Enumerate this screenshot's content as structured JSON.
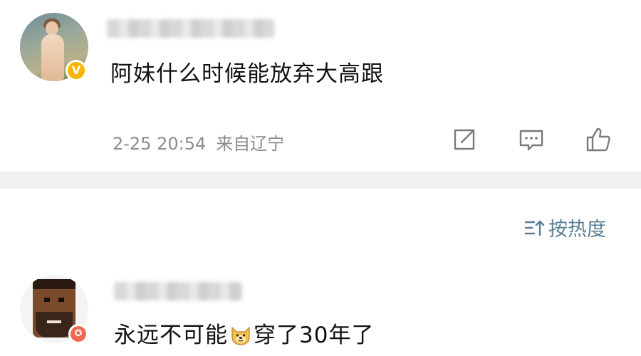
{
  "posts": [
    {
      "comment": "阿妹什么时候能放弃大高跟",
      "badge": "V",
      "meta": {
        "time": "2-25 20:54",
        "location": "来自辽宁"
      }
    },
    {
      "comment_before_emoji": "永远不可能",
      "emoji": "doge-emoji",
      "comment_after_emoji": "穿了30年了",
      "badge": "✪"
    }
  ],
  "sort": {
    "label": "按热度"
  },
  "colors": {
    "verified_badge": "#f7b500",
    "member_badge": "#f06a50",
    "meta_text": "#8c8c8c",
    "sort_accent": "#5b7f95",
    "divider": "#f0f0f0"
  },
  "icons": {
    "share": "share-icon",
    "comment": "comment-icon",
    "like": "like-icon",
    "sort": "sort-icon"
  }
}
